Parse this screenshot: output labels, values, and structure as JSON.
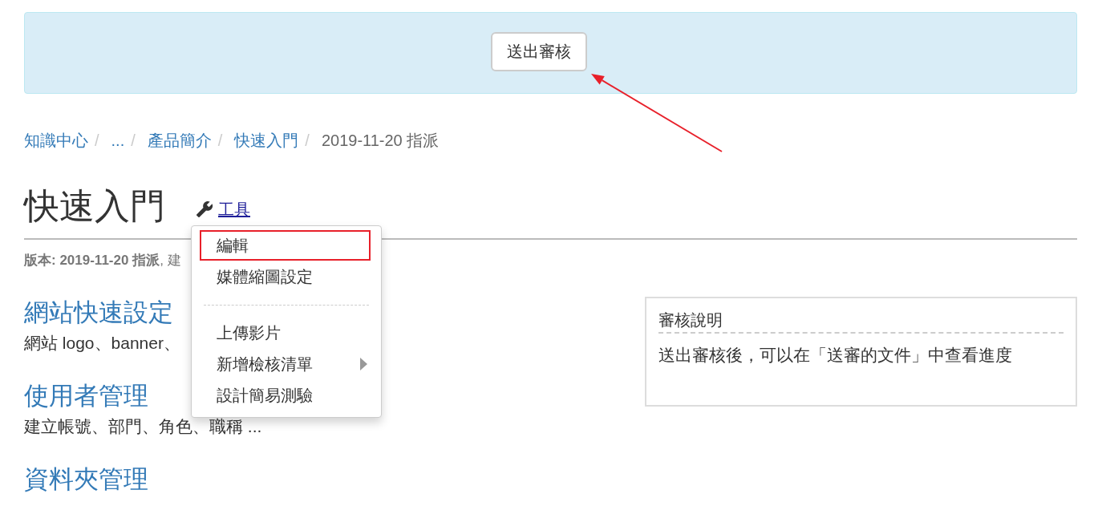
{
  "banner": {
    "button": "送出審核"
  },
  "breadcrumb": [
    {
      "label": "知識中心",
      "separator": "/",
      "current": false
    },
    {
      "label": "...",
      "separator": "/",
      "current": false
    },
    {
      "label": "產品簡介",
      "separator": "/",
      "current": false
    },
    {
      "label": "快速入門",
      "separator": "/",
      "current": false
    },
    {
      "label": "2019-11-20 指派",
      "current": true
    }
  ],
  "page": {
    "title": "快速入門",
    "tools_link": "工具"
  },
  "version_line": "**版本: 2019-11-20 指派**, 建",
  "sections": [
    {
      "heading": "網站快速設定",
      "description": "網站 logo、banner、"
    },
    {
      "heading": "使用者管理",
      "description": "建立帳號、部門、角色、職稱 ..."
    },
    {
      "heading": "資料夾管理"
    }
  ],
  "tools_menu": [
    {
      "kind": "item",
      "label": "編輯",
      "highlighted": true,
      "submenu": false
    },
    {
      "kind": "item",
      "label": "媒體縮圖設定",
      "highlighted": false,
      "submenu": false
    },
    {
      "kind": "divider"
    },
    {
      "kind": "item",
      "label": "上傳影片",
      "highlighted": false,
      "submenu": false
    },
    {
      "kind": "item",
      "label": "新增檢核清單",
      "highlighted": false,
      "submenu": true
    },
    {
      "kind": "item",
      "label": "設計簡易測驗",
      "highlighted": false,
      "submenu": false
    }
  ],
  "review_panel": {
    "title": "審核說明",
    "body": "送出審核後，可以在「送審的文件」中查看進度"
  }
}
